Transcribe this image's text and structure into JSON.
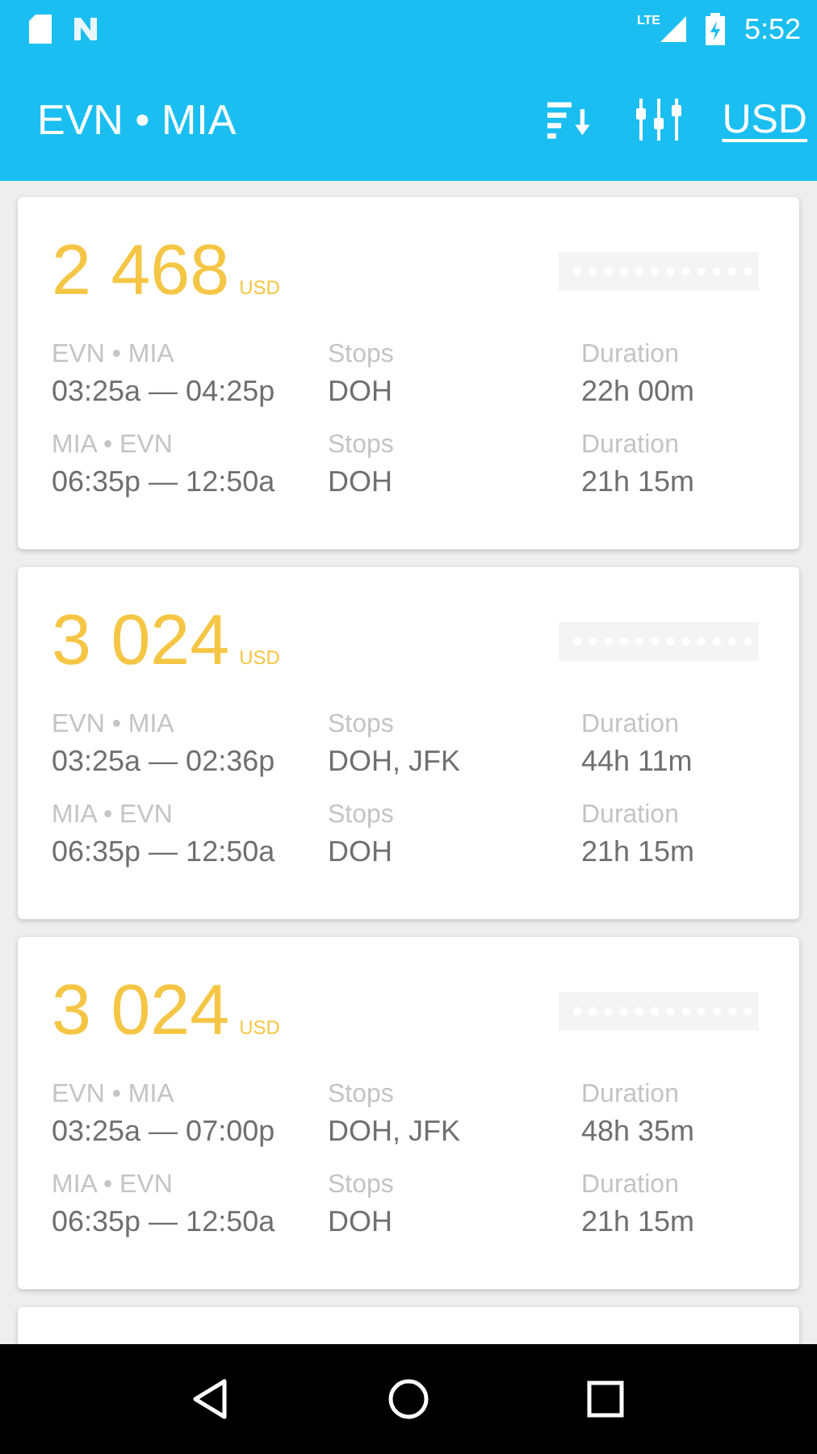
{
  "status_bar": {
    "network": "LTE",
    "time": "5:52"
  },
  "app_bar": {
    "title": "EVN • MIA",
    "currency": "USD"
  },
  "results": [
    {
      "price": "2 468",
      "currency": "USD",
      "legs": [
        {
          "route": "EVN • MIA",
          "times": "03:25a — 04:25p",
          "stops_label": "Stops",
          "stops": "DOH",
          "duration_label": "Duration",
          "duration": "22h 00m"
        },
        {
          "route": "MIA • EVN",
          "times": "06:35p — 12:50a",
          "stops_label": "Stops",
          "stops": "DOH",
          "duration_label": "Duration",
          "duration": "21h 15m"
        }
      ]
    },
    {
      "price": "3 024",
      "currency": "USD",
      "legs": [
        {
          "route": "EVN • MIA",
          "times": "03:25a — 02:36p",
          "stops_label": "Stops",
          "stops": "DOH, JFK",
          "duration_label": "Duration",
          "duration": "44h 11m"
        },
        {
          "route": "MIA • EVN",
          "times": "06:35p — 12:50a",
          "stops_label": "Stops",
          "stops": "DOH",
          "duration_label": "Duration",
          "duration": "21h 15m"
        }
      ]
    },
    {
      "price": "3 024",
      "currency": "USD",
      "legs": [
        {
          "route": "EVN • MIA",
          "times": "03:25a — 07:00p",
          "stops_label": "Stops",
          "stops": "DOH, JFK",
          "duration_label": "Duration",
          "duration": "48h 35m"
        },
        {
          "route": "MIA • EVN",
          "times": "06:35p — 12:50a",
          "stops_label": "Stops",
          "stops": "DOH",
          "duration_label": "Duration",
          "duration": "21h 15m"
        }
      ]
    }
  ]
}
